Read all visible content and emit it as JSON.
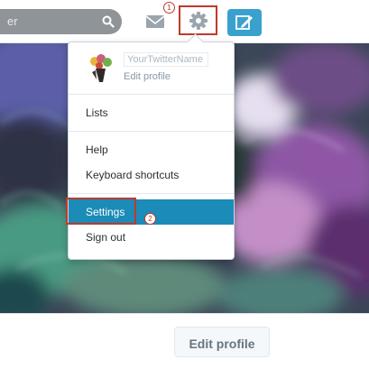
{
  "header": {
    "search_placeholder_fragment": "er",
    "annotation_step_1": "1"
  },
  "dropdown": {
    "username": "YourTwitterName",
    "edit_profile_link": "Edit profile",
    "items": [
      {
        "label": "Lists"
      },
      {
        "label": "Help"
      },
      {
        "label": "Keyboard shortcuts"
      },
      {
        "label": "Settings",
        "active": true
      },
      {
        "label": "Sign out"
      }
    ],
    "annotation_step_2": "2"
  },
  "profile": {
    "edit_profile_button": "Edit profile"
  },
  "colors": {
    "accent": "#3aa1cf",
    "highlight": "#1b8bb8",
    "annotation_red": "#c0392b"
  },
  "icons": [
    "search-icon",
    "mail-icon",
    "gear-icon",
    "compose-tweet-icon"
  ]
}
